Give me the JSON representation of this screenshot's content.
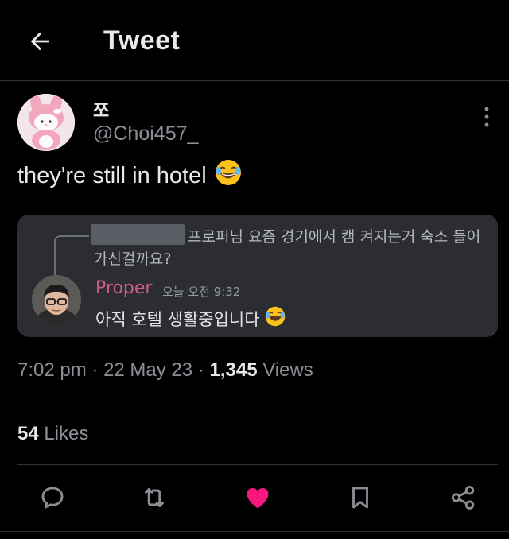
{
  "header": {
    "title": "Tweet",
    "back_icon": "arrow-left-icon"
  },
  "tweet": {
    "display_name": "쪼",
    "handle": "@Choi457_",
    "text": "they're still in hotel",
    "text_emoji": "face-with-tears-of-joy",
    "time": "7:02 pm",
    "date": "22 May 23",
    "views_count": "1,345",
    "views_label": "Views",
    "likes_count": "54",
    "likes_label": "Likes"
  },
  "embed": {
    "quoted_text": "프로퍼님 요즘 경기에서 캠 켜지는거 숙소 들어가신걸까요?",
    "author": "Proper",
    "timestamp": "오늘 오전 9:32",
    "message": "아직 호텔 생활중입니다",
    "message_emoji": "face-with-tears-of-joy"
  },
  "actions": {
    "reply": "reply-icon",
    "retweet": "retweet-icon",
    "like": "heart-icon",
    "bookmark": "bookmark-icon",
    "share": "share-icon"
  },
  "colors": {
    "background": "#000000",
    "text": "#e7e9ea",
    "secondary": "#8b9096",
    "like": "#f91880",
    "embed_bg": "#2b2d31",
    "embed_name": "#d15d8b"
  }
}
